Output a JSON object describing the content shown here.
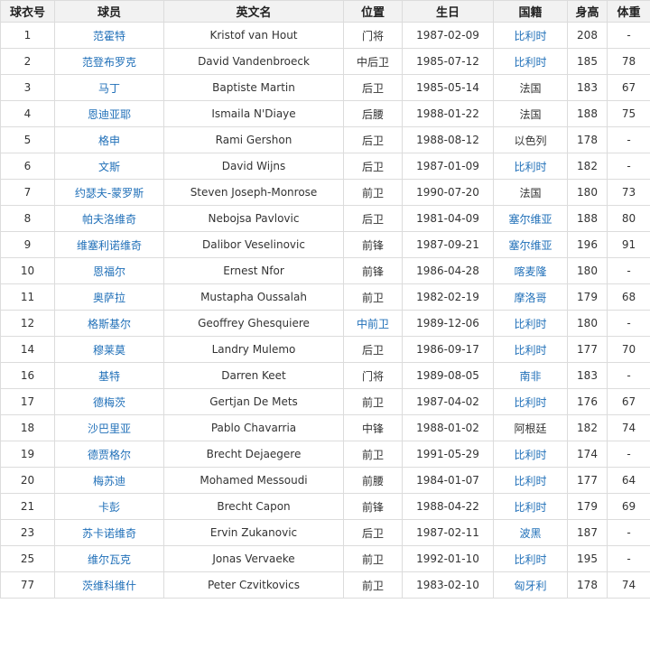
{
  "table": {
    "headers": [
      "球衣号",
      "球员",
      "英文名",
      "位置",
      "生日",
      "国籍",
      "身高",
      "体重"
    ],
    "rows": [
      {
        "no": "1",
        "name": "范霍特",
        "en": "Kristof van Hout",
        "pos": "门将",
        "birth": "1987-02-09",
        "nat": "比利时",
        "nat_link": true,
        "pos_link": false,
        "height": "208",
        "weight": "-"
      },
      {
        "no": "2",
        "name": "范登布罗克",
        "en": "David Vandenbroeck",
        "pos": "中后卫",
        "birth": "1985-07-12",
        "nat": "比利时",
        "nat_link": true,
        "pos_link": false,
        "height": "185",
        "weight": "78"
      },
      {
        "no": "3",
        "name": "马丁",
        "en": "Baptiste Martin",
        "pos": "后卫",
        "birth": "1985-05-14",
        "nat": "法国",
        "nat_link": false,
        "pos_link": false,
        "height": "183",
        "weight": "67"
      },
      {
        "no": "4",
        "name": "恩迪亚耶",
        "en": "Ismaila N'Diaye",
        "pos": "后腰",
        "birth": "1988-01-22",
        "nat": "法国",
        "nat_link": false,
        "pos_link": false,
        "height": "188",
        "weight": "75"
      },
      {
        "no": "5",
        "name": "格申",
        "en": "Rami Gershon",
        "pos": "后卫",
        "birth": "1988-08-12",
        "nat": "以色列",
        "nat_link": false,
        "pos_link": false,
        "height": "178",
        "weight": "-"
      },
      {
        "no": "6",
        "name": "文斯",
        "en": "David Wijns",
        "pos": "后卫",
        "birth": "1987-01-09",
        "nat": "比利时",
        "nat_link": true,
        "pos_link": false,
        "height": "182",
        "weight": "-"
      },
      {
        "no": "7",
        "name": "约瑟夫-蒙罗斯",
        "en": "Steven Joseph-Monrose",
        "pos": "前卫",
        "birth": "1990-07-20",
        "nat": "法国",
        "nat_link": false,
        "pos_link": false,
        "height": "180",
        "weight": "73"
      },
      {
        "no": "8",
        "name": "帕夫洛维奇",
        "en": "Nebojsa Pavlovic",
        "pos": "后卫",
        "birth": "1981-04-09",
        "nat": "塞尔维亚",
        "nat_link": true,
        "pos_link": false,
        "height": "188",
        "weight": "80"
      },
      {
        "no": "9",
        "name": "维塞利诺维奇",
        "en": "Dalibor Veselinovic",
        "pos": "前锋",
        "birth": "1987-09-21",
        "nat": "塞尔维亚",
        "nat_link": true,
        "pos_link": false,
        "height": "196",
        "weight": "91"
      },
      {
        "no": "10",
        "name": "恩福尔",
        "en": "Ernest Nfor",
        "pos": "前锋",
        "birth": "1986-04-28",
        "nat": "喀麦隆",
        "nat_link": true,
        "pos_link": false,
        "height": "180",
        "weight": "-"
      },
      {
        "no": "11",
        "name": "奥萨拉",
        "en": "Mustapha Oussalah",
        "pos": "前卫",
        "birth": "1982-02-19",
        "nat": "摩洛哥",
        "nat_link": true,
        "pos_link": false,
        "height": "179",
        "weight": "68"
      },
      {
        "no": "12",
        "name": "格斯基尔",
        "en": "Geoffrey Ghesquiere",
        "pos": "中前卫",
        "birth": "1989-12-06",
        "nat": "比利时",
        "nat_link": true,
        "pos_link": true,
        "height": "180",
        "weight": "-"
      },
      {
        "no": "14",
        "name": "穆莱莫",
        "en": "Landry Mulemo",
        "pos": "后卫",
        "birth": "1986-09-17",
        "nat": "比利时",
        "nat_link": true,
        "pos_link": false,
        "height": "177",
        "weight": "70"
      },
      {
        "no": "16",
        "name": "基特",
        "en": "Darren Keet",
        "pos": "门将",
        "birth": "1989-08-05",
        "nat": "南非",
        "nat_link": true,
        "pos_link": false,
        "height": "183",
        "weight": "-"
      },
      {
        "no": "17",
        "name": "德梅茨",
        "en": "Gertjan De Mets",
        "pos": "前卫",
        "birth": "1987-04-02",
        "nat": "比利时",
        "nat_link": true,
        "pos_link": false,
        "height": "176",
        "weight": "67"
      },
      {
        "no": "18",
        "name": "沙巴里亚",
        "en": "Pablo Chavarria",
        "pos": "中锋",
        "birth": "1988-01-02",
        "nat": "阿根廷",
        "nat_link": false,
        "pos_link": false,
        "height": "182",
        "weight": "74"
      },
      {
        "no": "19",
        "name": "德贾格尔",
        "en": "Brecht Dejaegere",
        "pos": "前卫",
        "birth": "1991-05-29",
        "nat": "比利时",
        "nat_link": true,
        "pos_link": false,
        "height": "174",
        "weight": "-"
      },
      {
        "no": "20",
        "name": "梅苏迪",
        "en": "Mohamed Messoudi",
        "pos": "前腰",
        "birth": "1984-01-07",
        "nat": "比利时",
        "nat_link": true,
        "pos_link": false,
        "height": "177",
        "weight": "64"
      },
      {
        "no": "21",
        "name": "卡彭",
        "en": "Brecht Capon",
        "pos": "前锋",
        "birth": "1988-04-22",
        "nat": "比利时",
        "nat_link": true,
        "pos_link": false,
        "height": "179",
        "weight": "69"
      },
      {
        "no": "23",
        "name": "苏卡诺维奇",
        "en": "Ervin Zukanovic",
        "pos": "后卫",
        "birth": "1987-02-11",
        "nat": "波黑",
        "nat_link": true,
        "pos_link": false,
        "height": "187",
        "weight": "-"
      },
      {
        "no": "25",
        "name": "维尔瓦克",
        "en": "Jonas Vervaeke",
        "pos": "前卫",
        "birth": "1992-01-10",
        "nat": "比利时",
        "nat_link": true,
        "pos_link": false,
        "height": "195",
        "weight": "-"
      },
      {
        "no": "77",
        "name": "茨维科维什",
        "en": "Peter Czvitkovics",
        "pos": "前卫",
        "birth": "1983-02-10",
        "nat": "匈牙利",
        "nat_link": true,
        "pos_link": false,
        "height": "178",
        "weight": "74"
      }
    ]
  },
  "colors": {
    "link": "#1f6fb8",
    "header_bg": "#f2f2f2",
    "border": "#dcdcdc"
  }
}
